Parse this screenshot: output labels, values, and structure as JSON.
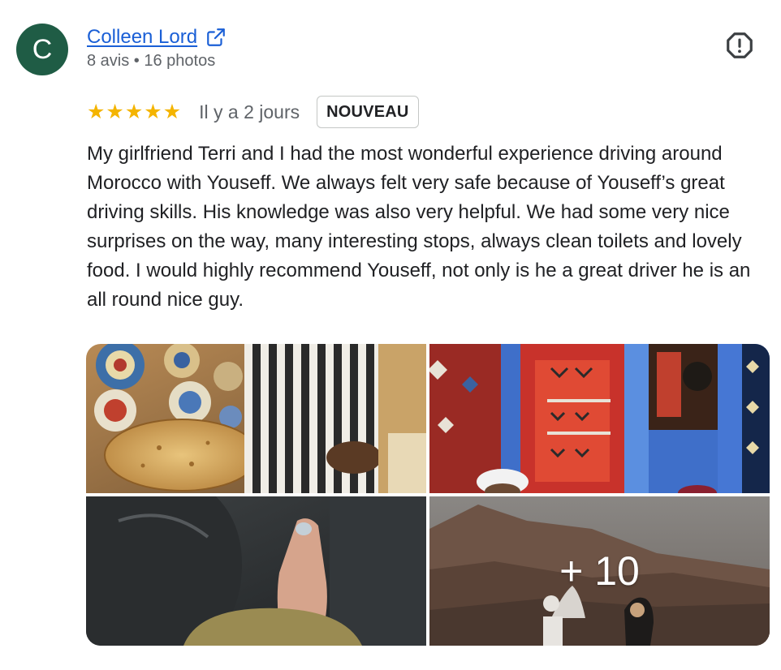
{
  "review": {
    "author": {
      "initial": "C",
      "name": "Colleen Lord",
      "meta": "8 avis • 16 photos",
      "avatar_color": "#1f5c45"
    },
    "icons": {
      "external_link": "external-link-icon",
      "report": "report-octagon-icon",
      "star": "star-icon"
    },
    "rating": {
      "stars": 5,
      "max": 5,
      "star_glyph": "★",
      "star_color": "#f4b400"
    },
    "date": "Il y a 2 jours",
    "badge": "NOUVEAU",
    "text": "My girlfriend Terri and I had the most wonderful experience driving around Morocco with Youseff. We always felt very safe because of Youseff’s great driving skills. His knowledge was also very helpful. We had some very nice surprises on the way, many interesting stops, always clean toilets and lovely food. I would highly recommend Youseff, not only is he a great driver he is an all round nice guy.",
    "photos": {
      "items": [
        {
          "name": "photo-bread"
        },
        {
          "name": "photo-carpets"
        },
        {
          "name": "photo-car-foot"
        },
        {
          "name": "photo-mountain"
        }
      ],
      "more_label": "+ 10"
    },
    "colors": {
      "link": "#1a5fd6",
      "secondary_text": "#5f6368",
      "primary_text": "#202124"
    }
  }
}
